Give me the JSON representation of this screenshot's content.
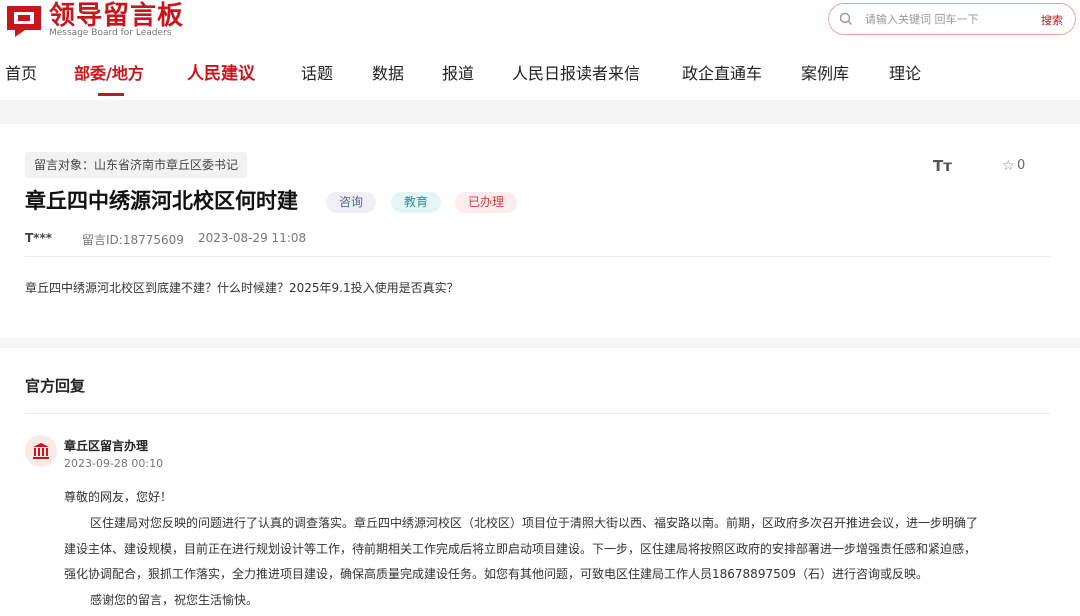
{
  "brand": {
    "title": "领导留言板",
    "subtitle": "Message Board for Leaders",
    "logo_icon": "message-board-logo-icon",
    "accent_color": "#c8161d"
  },
  "search": {
    "placeholder": "请输入关键词 回车一下",
    "button_label": "搜索",
    "icon": "search-icon"
  },
  "nav": {
    "items": [
      {
        "label": "首页"
      },
      {
        "label": "部委/地方",
        "active": true
      },
      {
        "label": "人民建议"
      },
      {
        "label": "话题"
      },
      {
        "label": "数据"
      },
      {
        "label": "报道"
      },
      {
        "label": "人民日报读者来信"
      },
      {
        "label": "政企直通车"
      },
      {
        "label": "案例库"
      },
      {
        "label": "理论"
      }
    ]
  },
  "message": {
    "target": "留言对象：山东省济南市章丘区委书记",
    "title": "章丘四中绣源河北校区何时建",
    "tags": [
      "咨询",
      "教育",
      "已办理"
    ],
    "user": "T***",
    "id_text": "留言ID:18775609",
    "time": "2023-08-29 11:08",
    "body": "章丘四中绣源河北校区到底建不建？什么时候建？2025年9.1投入使用是否真实？",
    "fontsize_icon": "Tт",
    "star_count": "0"
  },
  "reply": {
    "heading": "官方回复",
    "org_name": "章丘区留言办理",
    "time": "2023-09-28 00:10",
    "greeting": "尊敬的网友，您好！",
    "lines": [
      "区住建局对您反映的问题进行了认真的调查落实。章丘四中绣源河校区（北校区）项目位于清照大街以西、福安路以南。前期，区政府多次召开推进会议，进一步明确了",
      "建设主体、建设规模，目前正在进行规划设计等工作，待前期相关工作完成后将立即启动项目建设。下一步，区住建局将按照区政府的安排部署进一步增强责任感和紧迫感，",
      "强化协调配合，狠抓工作落实，全力推进项目建设，确保高质量完成建设任务。如您有其他问题，可致电区住建局工作人员18678897509（石）进行咨询或反映。"
    ],
    "closing": "感谢您的留言，祝您生活愉快。"
  }
}
